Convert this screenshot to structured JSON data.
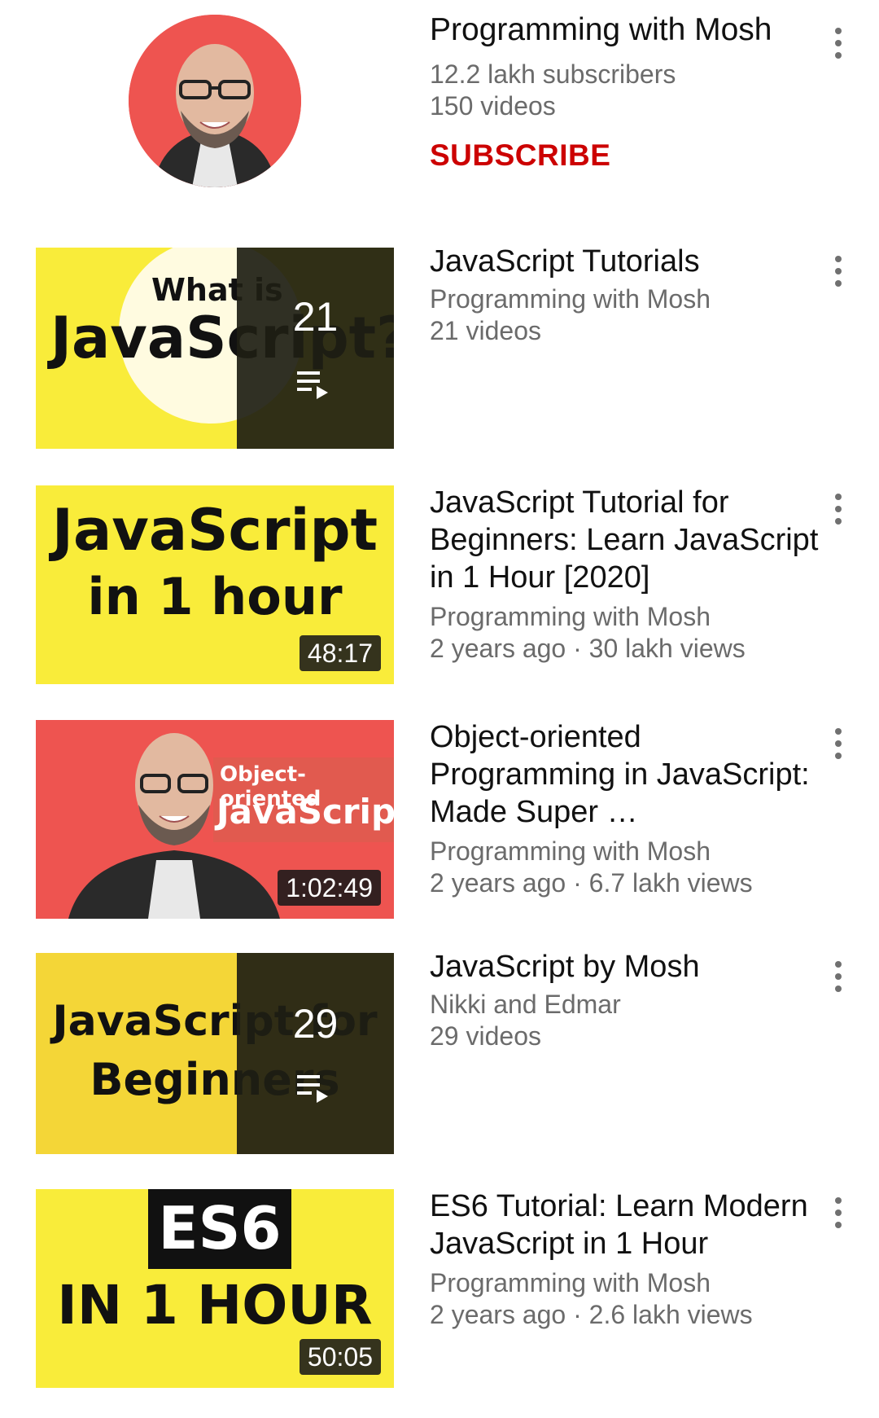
{
  "channel": {
    "name": "Programming with Mosh",
    "subscribers": "12.2 lakh subscribers",
    "videos": "150 videos",
    "subscribe_label": "SUBSCRIBE"
  },
  "items": [
    {
      "type": "playlist",
      "title": "JavaScript Tutorials",
      "channel": "Programming with Mosh",
      "meta": "21 videos",
      "count": "21",
      "thumb_text_1": "What is",
      "thumb_text_2": "JavaScript?"
    },
    {
      "type": "video",
      "title": "JavaScript Tutorial for Beginners: Learn JavaScript in 1 Hour [2020]",
      "channel": "Programming with Mosh",
      "meta": "2 years ago · 30 lakh views",
      "duration": "48:17",
      "thumb_text_1": "JavaScript",
      "thumb_text_2": "in 1 hour"
    },
    {
      "type": "video",
      "title": "Object-oriented Programming in JavaScript: Made Super …",
      "channel": "Programming with Mosh",
      "meta": "2 years ago · 6.7 lakh views",
      "duration": "1:02:49",
      "thumb_text_1": "Object-oriented",
      "thumb_text_2": "JavaScript"
    },
    {
      "type": "playlist",
      "title": "JavaScript by Mosh",
      "channel": "Nikki and Edmar",
      "meta": "29 videos",
      "count": "29",
      "thumb_text_1": "JavaScript for",
      "thumb_text_2": "Beginners"
    },
    {
      "type": "video",
      "title": "ES6 Tutorial: Learn Modern JavaScript in 1 Hour",
      "channel": "Programming with Mosh",
      "meta": "2 years ago · 2.6 lakh views",
      "duration": "50:05",
      "thumb_text_1": "ES6",
      "thumb_text_2": "IN 1 HOUR"
    }
  ],
  "icons": {
    "menu": "more-vert-icon",
    "playlist": "playlist-play-icon"
  },
  "colors": {
    "subscribe": "#cc0000",
    "thumb_yellow": "#f9ec3a",
    "thumb_red": "#ee5450"
  }
}
